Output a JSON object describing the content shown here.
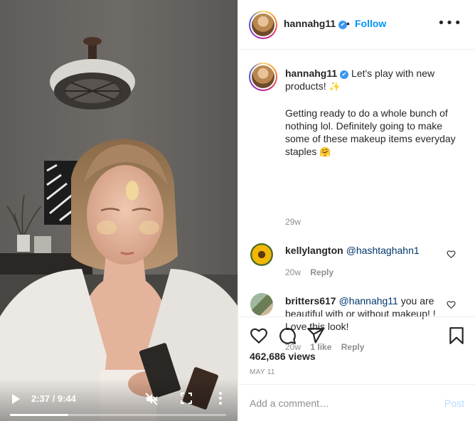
{
  "video": {
    "time_display": "2:37 / 9:44",
    "progress_fraction": 0.269,
    "icons": [
      "play-icon",
      "mute-icon",
      "fullscreen-icon",
      "more-vertical-icon"
    ]
  },
  "header": {
    "username": "hannahg11",
    "verified_glyph": "✔",
    "separator": "•",
    "follow_label": "Follow",
    "more_glyph": "•••"
  },
  "caption": {
    "username": "hannahg11",
    "verified_glyph": "✔",
    "text_line1": "Let's play with new products!",
    "emoji1": "✨",
    "text_body": "Getting ready to do a whole bunch of nothing lol. Definitely going to make some of these makeup items everyday staples",
    "emoji2": "🤗",
    "time": "29w"
  },
  "comments": [
    {
      "username": "kellylangton",
      "mention": "@hashtaghahn1",
      "text": "",
      "time": "20w",
      "likes": "",
      "reply_label": "Reply"
    },
    {
      "username": "britters617",
      "mention": "@hannahg11",
      "text": "you are beautiful with or without makeup! ! Love this look!",
      "time": "20w",
      "likes": "1 like",
      "reply_label": "Reply"
    }
  ],
  "stats": {
    "views": "462,686 views",
    "date": "MAY 11"
  },
  "add_comment": {
    "placeholder": "Add a comment…",
    "post_label": "Post"
  },
  "colors": {
    "accent": "#0095f6",
    "verified": "#3897f0",
    "muted": "#8e8e8e",
    "post_disabled": "#b3dbff"
  }
}
